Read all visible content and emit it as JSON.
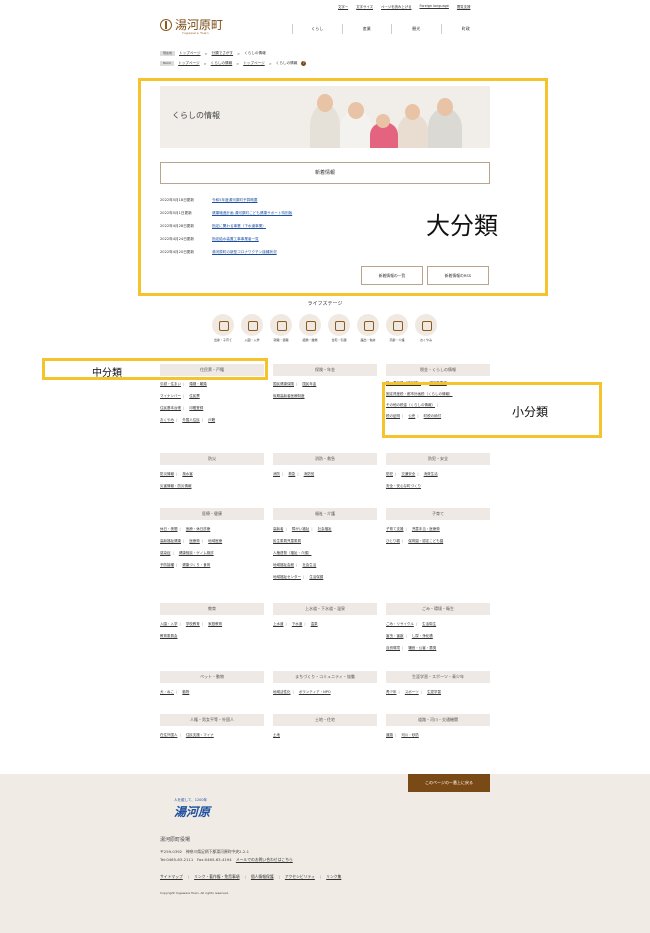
{
  "header": {
    "logo_name": "湯河原町",
    "logo_sub": "Yugawara Town",
    "util_links": [
      "文字一",
      "文字サイズ",
      "ページを読み上げる",
      "Foreign language",
      "閲覧支援"
    ],
    "gnav": [
      "くらし",
      "産業",
      "観光",
      "町政"
    ]
  },
  "breadcrumbs": {
    "b1_tag": "現在地",
    "b1": [
      "トップページ",
      "分類でさがす",
      "くらしの情報"
    ],
    "b2_tag": "BACK",
    "b2": [
      "トップページ",
      "くらしの情報",
      "トップページ",
      "くらしの情報"
    ]
  },
  "hero_title": "くらしの情報",
  "news": {
    "header": "新着情報",
    "items": [
      {
        "date": "2022年5月18日更新",
        "title": "令和5年度湯河原町予算概要"
      },
      {
        "date": "2022年5月1日更新",
        "title": "健康増進計画 湯河原町こども健康サポート特別版"
      },
      {
        "date": "2022年4月28日更新",
        "title": "指定に関わる事業（下水道事業）"
      },
      {
        "date": "2022年4月24日更新",
        "title": "指定給水装置工事事業者一覧"
      },
      {
        "date": "2022年4月20日更新",
        "title": "湯河原町の新型コロナワクチン接種状況"
      }
    ],
    "btn_list": "新着情報の一覧",
    "btn_rss": "新着情報のRSS"
  },
  "annotations": {
    "large": "大分類",
    "mid": "中分類",
    "small": "小分類"
  },
  "life_stage": {
    "title": "ライフステージ",
    "items": [
      "出産・子育て",
      "入園・入学",
      "就職・退職",
      "結婚・離婚",
      "住宅・引越",
      "届出・免許",
      "高齢・介護",
      "おくやみ"
    ]
  },
  "categories": [
    {
      "head": "住民票・戸籍",
      "links": [
        "引越・住まい",
        "婚姻・離婚",
        "マイナンバー",
        "住民票",
        "住民基本台帳",
        "印鑑登録",
        "おくやみ",
        "外国人住民",
        "戸籍"
      ]
    },
    {
      "head": "保険・年金",
      "links": [
        "国民健康保険",
        "国民年金",
        "後期高齢者医療制度"
      ]
    },
    {
      "head": "税金・くらしの情報",
      "links": [
        "町・県民税（住民税）",
        "軽自動車税",
        "固定資産税・都市計画税（くらしの情報）",
        "その他の税金（くらしの情報）",
        "税の証明",
        "公売",
        "町税の納付"
      ]
    },
    {
      "head": "防災",
      "links": [
        "防災情報",
        "風水害",
        "災害情報・防災情報"
      ]
    },
    {
      "head": "消防・救急",
      "links": [
        "消防",
        "救急",
        "消防団"
      ]
    },
    {
      "head": "防犯・安全",
      "links": [
        "防犯",
        "交通安全",
        "消費生活",
        "安全・安心な町づくり"
      ]
    },
    {
      "head": "医療・健康",
      "links": [
        "休日・夜間",
        "医療・休日診療",
        "高齢福祉健康",
        "医療費",
        "地域医療",
        "感染症",
        "健康相談・ゲノム検診",
        "予防接種",
        "健康づくり・食育"
      ]
    },
    {
      "head": "福祉・介護",
      "links": [
        "高齢者",
        "障がい福祉",
        "社会福祉",
        "民生委員児童委員",
        "人権啓発（福祉・介護）",
        "地域福祉会館",
        "社会生活",
        "地域福祉センター",
        "生活保護"
      ]
    },
    {
      "head": "子育て",
      "links": [
        "子育て支援",
        "児童手当・医療費",
        "ひとり親",
        "保育園・認定こども園"
      ]
    },
    {
      "head": "教育",
      "links": [
        "入園・入学",
        "学校教育",
        "家庭教育",
        "教育委員会"
      ]
    },
    {
      "head": "上水道・下水道・温泉",
      "links": [
        "上水道",
        "下水道",
        "温泉"
      ]
    },
    {
      "head": "ごみ・環境・衛生",
      "links": [
        "ごみ・リサイクル",
        "生活衛生",
        "害虫・害獣",
        "し尿・浄化槽",
        "自然環境",
        "騒音・公害・悪臭"
      ]
    },
    {
      "head": "ペット・動物",
      "links": [
        "犬・ねこ",
        "動物"
      ]
    },
    {
      "head": "まちづくり・コミュニティ・協働",
      "links": [
        "地域活性化",
        "ボランティア・NPO"
      ]
    },
    {
      "head": "生涯学習・スポーツ・青少年",
      "links": [
        "青少年",
        "スポーツ",
        "生涯学習"
      ]
    },
    {
      "head": "人権・男女平等・外国人",
      "links": [
        "在住外国人",
        "住民支援・マイナ"
      ]
    },
    {
      "head": "土地・住宅",
      "links": [
        "土地"
      ]
    },
    {
      "head": "道路・河川・交通機関",
      "links": [
        "道路",
        "河川・砂防"
      ]
    }
  ],
  "footer": {
    "back_to_top": "このページの一番上に戻る",
    "logo_small": "人を癒して、1200年",
    "logo_big": "湯河原",
    "office": "湯河原町役場",
    "address": "〒259-0392　神奈川県足柄下郡湯河原町中央2-2-1",
    "tel": "Tel:0465-63-2111　Fax:0465-63-4194",
    "mail_link": "メールでのお問い合わせはこちら",
    "links": [
      "サイトマップ",
      "リンク・著作権・免責事項",
      "個人情報保護",
      "アクセシビリティ",
      "リンク集"
    ],
    "copyright": "Copyright Yugawara Town. All rights reserved."
  }
}
